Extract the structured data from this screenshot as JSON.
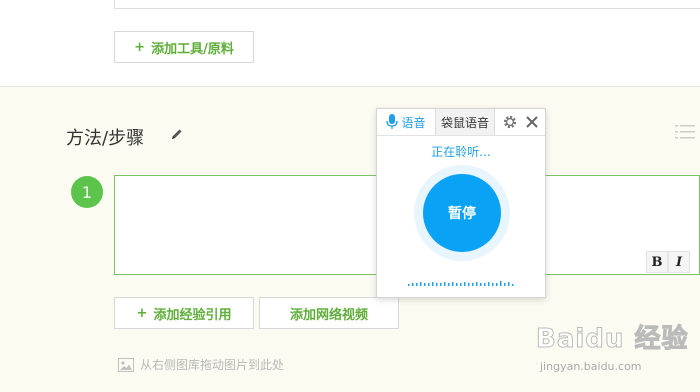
{
  "tools": {
    "add_tool_label": "添加工具/原料"
  },
  "steps_section": {
    "title": "方法/步骤",
    "step_number": "1",
    "format_bold": "B",
    "format_italic": "I",
    "add_reference_label": "添加经验引用",
    "add_video_label": "添加网络视频",
    "drag_hint": "从右侧图库拖动图片到此处"
  },
  "voice_panel": {
    "tab_voice": "语音",
    "tab_kangaroo": "袋鼠语音",
    "status": "正在聆听...",
    "pause_label": "暂停"
  },
  "watermark": {
    "brand": "Baidu 经验",
    "url": "jingyan.baidu.com"
  },
  "colors": {
    "accent_green": "#5fae3a",
    "step_green": "#5cc44a",
    "voice_blue": "#0aa2f5",
    "link_blue": "#1ea0e6"
  },
  "icons": [
    "plus-icon",
    "pencil-icon",
    "list-icon",
    "microphone-icon",
    "gear-icon",
    "close-icon",
    "image-icon"
  ]
}
